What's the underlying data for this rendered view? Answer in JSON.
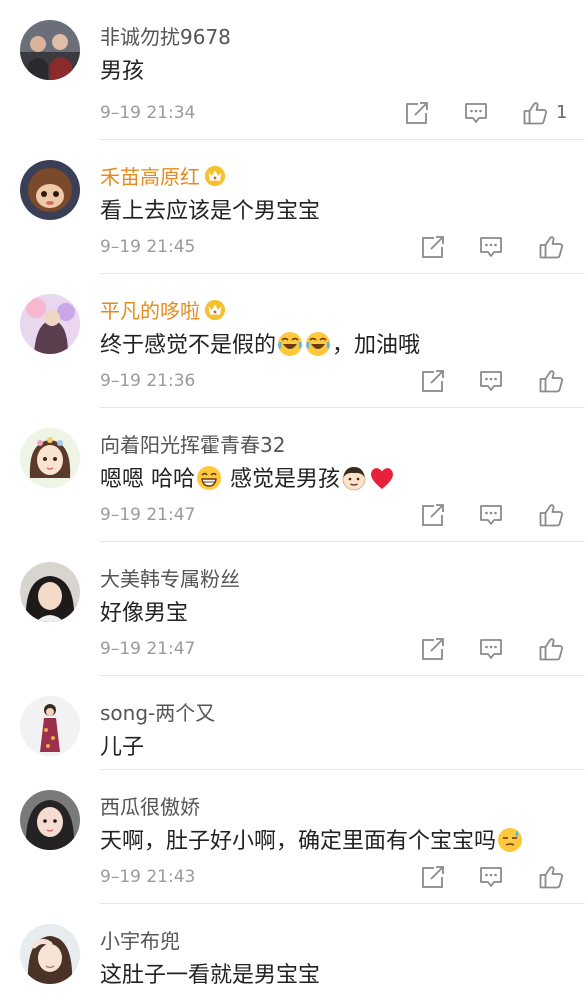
{
  "comments": [
    {
      "username": "非诚勿扰9678",
      "text": "男孩",
      "time": "9–19 21:34",
      "like_count": "1"
    },
    {
      "username": "禾苗高原红",
      "text": "看上去应该是个男宝宝",
      "time": "9–19 21:45"
    },
    {
      "username": "平凡的哆啦",
      "text_before": "终于感觉不是假的",
      "text_after": "，加油哦",
      "time": "9–19 21:36"
    },
    {
      "username": "向着阳光挥霍青春32",
      "text_a": "嗯嗯 哈哈",
      "text_b": " 感觉是男孩",
      "time": "9–19 21:47"
    },
    {
      "username": "大美韩专属粉丝",
      "text": "好像男宝",
      "time": "9–19 21:47"
    },
    {
      "username": "song-两个又",
      "text": "儿子"
    },
    {
      "username": "西瓜很傲娇",
      "text": "天啊，肚子好小啊，确定里面有个宝宝吗",
      "time": "9–19 21:43"
    },
    {
      "username": "小宇布兜",
      "text": "这肚子一看就是男宝宝"
    }
  ],
  "icons": {
    "share": "share-icon",
    "comment": "comment-icon",
    "like": "thumbs-up-icon",
    "crown": "vip-crown-icon",
    "laugh": "laughing-tears-emoji",
    "grin": "grinning-emoji",
    "boy": "boy-face-emoji",
    "heart": "red-heart-emoji",
    "sweat": "sweat-emoji"
  },
  "colors": {
    "username": "#555555",
    "vip_username": "#e48b1e",
    "text": "#222222",
    "time": "#9a9a9a",
    "divider": "#e6e6e6"
  }
}
